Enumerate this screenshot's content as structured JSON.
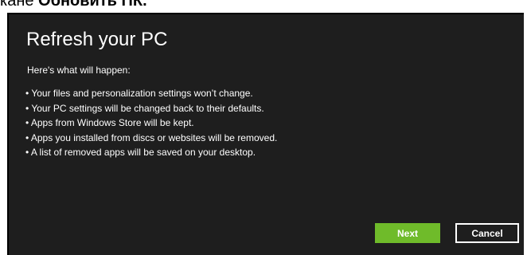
{
  "caption": {
    "prefix": "кане ",
    "bold": "Обновить ПК."
  },
  "dialog": {
    "title": "Refresh your PC",
    "intro": "Here's what will happen:",
    "bullets": [
      "• Your files and personalization settings won’t change.",
      "• Your PC settings will be changed back to their defaults.",
      "• Apps from Windows Store will be kept.",
      "• Apps you installed from discs or websites will be removed.",
      "• A list of removed apps will be saved on your desktop."
    ],
    "next_label": "Next",
    "cancel_label": "Cancel"
  },
  "colors": {
    "dialog_bg": "#1e1e1e",
    "accent_green": "#6fbb2a",
    "text": "#ffffff"
  }
}
